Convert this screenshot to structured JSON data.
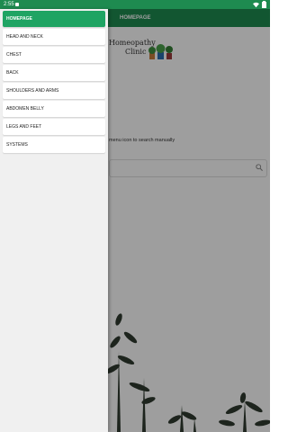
{
  "status": {
    "time": "2:55"
  },
  "appbar": {
    "title": "HOMEPAGE"
  },
  "brand": {
    "line1": "Homeopathy",
    "line2": "Clinic"
  },
  "main": {
    "hint": "menu icon to search manually"
  },
  "colors": {
    "primary": "#1e8b50",
    "active": "#1fa463"
  },
  "drawer": {
    "items": [
      {
        "label": "HOMEPAGE"
      },
      {
        "label": "HEAD AND NECK"
      },
      {
        "label": "CHEST"
      },
      {
        "label": "BACK"
      },
      {
        "label": "SHOULDERS AND ARMS"
      },
      {
        "label": "ABDOMEN BELLY"
      },
      {
        "label": "LEGS AND FEET"
      },
      {
        "label": "SYSTEMS"
      }
    ]
  },
  "icons": {
    "search": "search-icon",
    "wifi": "wifi-icon",
    "battery": "battery-icon"
  }
}
